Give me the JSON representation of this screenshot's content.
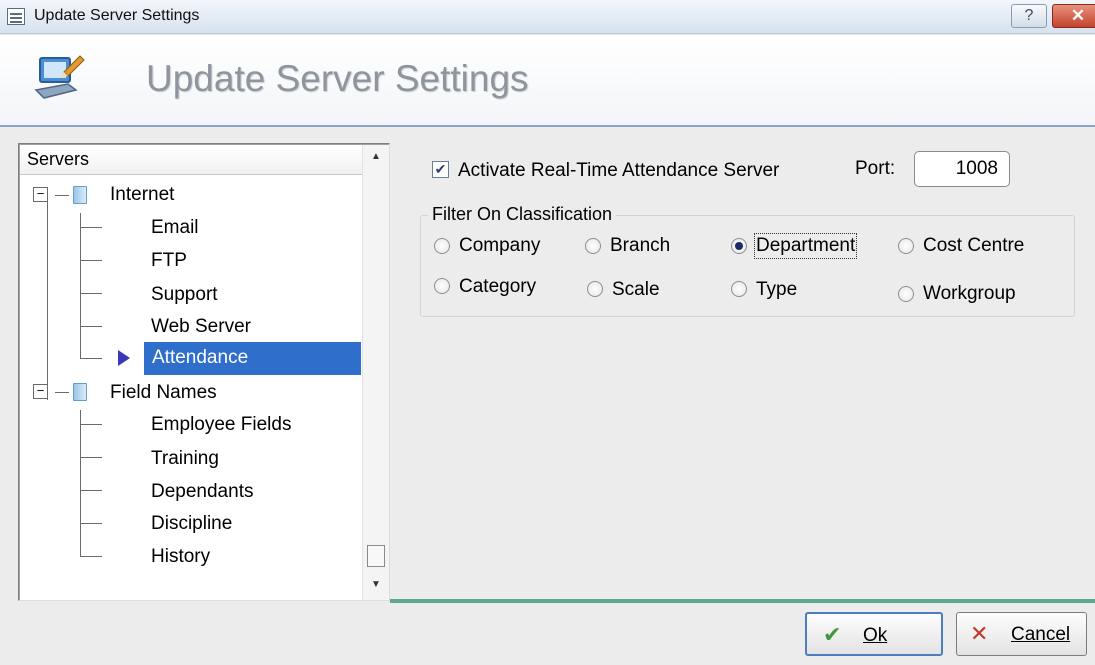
{
  "window": {
    "title": "Update Server Settings",
    "help_glyph": "?",
    "close_glyph": "✕"
  },
  "header": {
    "title": "Update Server Settings"
  },
  "tree": {
    "header": "Servers",
    "groups": [
      {
        "label": "Internet",
        "children": [
          "Email",
          "FTP",
          "Support",
          "Web Server",
          "Attendance"
        ]
      },
      {
        "label": "Field Names",
        "children": [
          "Employee Fields",
          "Training",
          "Dependants",
          "Discipline",
          "History"
        ]
      }
    ],
    "selected": "Attendance"
  },
  "settings": {
    "activate_label": "Activate Real-Time Attendance Server",
    "activate_checked": true,
    "port_label": "Port:",
    "port_value": "1008",
    "filter_legend": "Filter On Classification",
    "options": [
      "Company",
      "Branch",
      "Department",
      "Cost Centre",
      "Category",
      "Scale",
      "Type",
      "Workgroup"
    ],
    "selected_option": "Department"
  },
  "buttons": {
    "ok": "Ok",
    "cancel": "Cancel"
  },
  "colors": {
    "selection": "#2f6ecb",
    "accent_line": "#5da88b",
    "ok_glyph": "#3f9a3f",
    "cancel_glyph": "#c0392b"
  },
  "icons": [
    "app-icon",
    "help-icon",
    "close-icon",
    "computer-settings-icon",
    "folder-icon",
    "checkmark-icon",
    "cross-icon"
  ]
}
